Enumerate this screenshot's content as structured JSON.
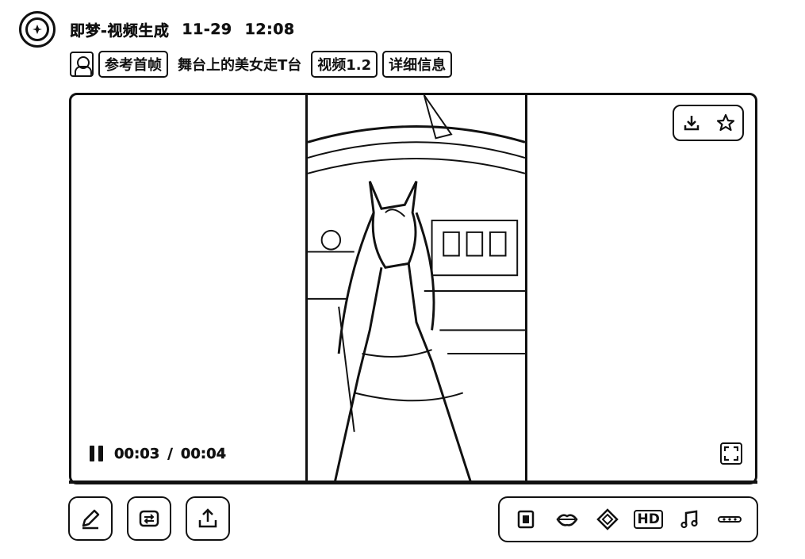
{
  "header": {
    "app_title": "即梦-视频生成",
    "date": "11-29",
    "time": "12:08",
    "logo_icon": "app-logo-icon"
  },
  "task": {
    "ref_label": "参考首帧",
    "prompt": "舞台上的美女走T台",
    "model_label": "视频1.2",
    "detail_label": "详细信息"
  },
  "player": {
    "current_time": "00:03",
    "separator": "/",
    "total_time": "00:04",
    "state": "playing",
    "progress": 0.75,
    "actions": [
      "download-icon",
      "star-icon"
    ]
  },
  "toolbar": {
    "left": [
      "edit-icon",
      "regenerate-icon",
      "share-icon"
    ],
    "right": [
      "frame-icon",
      "lip-sync-icon",
      "diamond-icon",
      "hd-icon",
      "music-icon",
      "more-icon"
    ],
    "hd_text": "HD"
  },
  "colors": {
    "ink": "#111111",
    "background": "#ffffff"
  }
}
